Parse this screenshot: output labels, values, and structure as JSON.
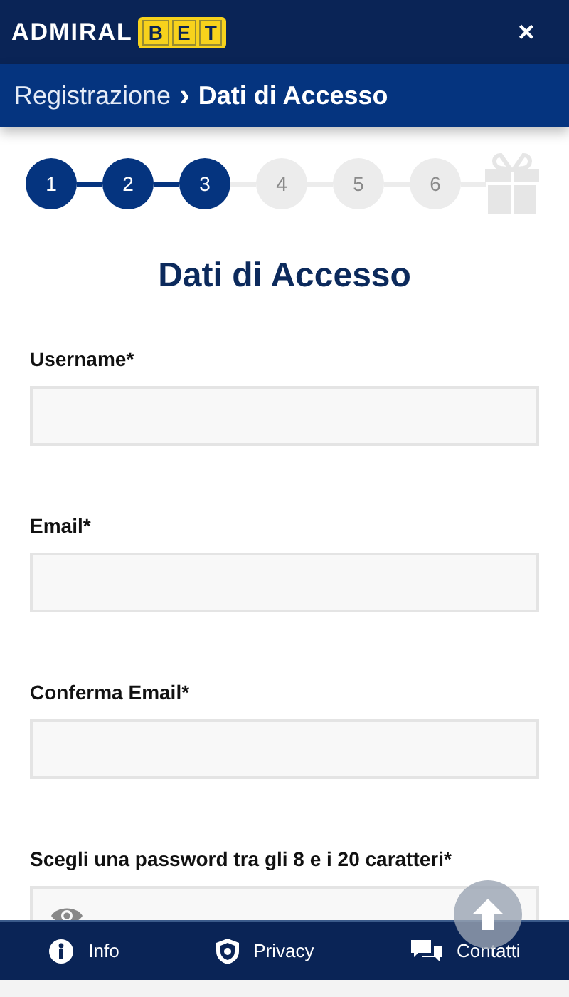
{
  "header": {
    "logo": {
      "word": "ADMIRAL",
      "boxed": [
        "B",
        "E",
        "T"
      ]
    },
    "close": "×"
  },
  "breadcrumb": {
    "parent": "Registrazione",
    "separator": "›",
    "current": "Dati di Accesso"
  },
  "steps": [
    {
      "label": "1",
      "done": true
    },
    {
      "label": "2",
      "done": true
    },
    {
      "label": "3",
      "done": true
    },
    {
      "label": "4",
      "done": false
    },
    {
      "label": "5",
      "done": false
    },
    {
      "label": "6",
      "done": false
    }
  ],
  "title": "Dati di Accesso",
  "fields": [
    {
      "label": "Username*",
      "kind": "text"
    },
    {
      "label": "Email*",
      "kind": "text"
    },
    {
      "label": "Conferma Email*",
      "kind": "text"
    },
    {
      "label": "Scegli una password tra gli 8 e i 20 caratteri*",
      "kind": "password"
    }
  ],
  "footer": [
    {
      "label": "Info",
      "kind": "info"
    },
    {
      "label": "Privacy",
      "kind": "privacy"
    },
    {
      "label": "Contatti",
      "kind": "chat"
    }
  ]
}
